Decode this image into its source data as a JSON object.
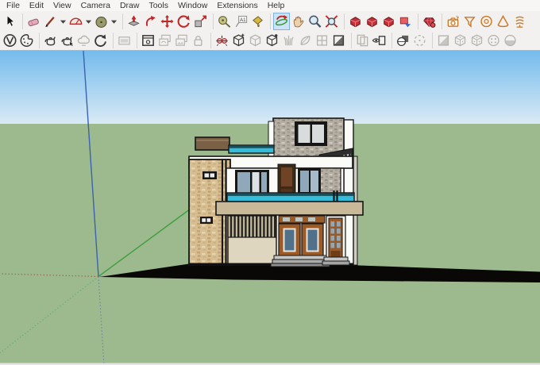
{
  "menu": {
    "items": [
      "File",
      "Edit",
      "View",
      "Camera",
      "Draw",
      "Tools",
      "Window",
      "Extensions",
      "Help"
    ]
  },
  "toolbars": {
    "row1": [
      {
        "name": "select-tool",
        "glyph": "cursor"
      },
      {
        "glyph": "sep"
      },
      {
        "name": "eraser-tool",
        "glyph": "eraser"
      },
      {
        "name": "line-tool",
        "glyph": "pencil"
      },
      {
        "name": "line-tool-dropdown",
        "glyph": "dd"
      },
      {
        "name": "arc-tool",
        "glyph": "protractor"
      },
      {
        "name": "arc-tool-dropdown",
        "glyph": "dd"
      },
      {
        "name": "shape-tool",
        "glyph": "circle"
      },
      {
        "name": "shape-tool-dropdown",
        "glyph": "dd"
      },
      {
        "glyph": "sep"
      },
      {
        "name": "push-pull-tool",
        "glyph": "pushpull"
      },
      {
        "name": "follow-me-tool",
        "glyph": "followme"
      },
      {
        "name": "move-tool",
        "glyph": "movecross"
      },
      {
        "name": "rotate-tool",
        "glyph": "rotate2"
      },
      {
        "name": "scale-tool",
        "glyph": "scale"
      },
      {
        "glyph": "sep"
      },
      {
        "name": "tape-measure-tool",
        "glyph": "tape"
      },
      {
        "name": "dimension-tool",
        "glyph": "textA1"
      },
      {
        "name": "paint-bucket-tool",
        "glyph": "bucket"
      },
      {
        "glyph": "sep"
      },
      {
        "name": "orbit-tool",
        "glyph": "orbit",
        "sel": true
      },
      {
        "name": "pan-tool",
        "glyph": "hand"
      },
      {
        "name": "zoom-tool",
        "glyph": "mag"
      },
      {
        "name": "zoom-extents-tool",
        "glyph": "magext"
      },
      {
        "glyph": "sep"
      },
      {
        "name": "position-camera-tool",
        "glyph": "redbox"
      },
      {
        "name": "look-around-tool",
        "glyph": "redbox"
      },
      {
        "name": "walk-tool",
        "glyph": "redbox"
      },
      {
        "name": "section-plane-tool",
        "glyph": "redblue"
      },
      {
        "glyph": "sep"
      },
      {
        "name": "match-photo-tool",
        "glyph": "gem"
      },
      {
        "glyph": "sep"
      },
      {
        "name": "scenes-camera-tool",
        "glyph": "camstar",
        "c": "#C87828"
      },
      {
        "name": "shape-funnel-tool",
        "glyph": "funnel",
        "c": "#C87828"
      },
      {
        "name": "shape-torus-tool",
        "glyph": "torus",
        "c": "#C87828"
      },
      {
        "name": "shape-cone-tool",
        "glyph": "cone",
        "c": "#C87828"
      },
      {
        "name": "shape-spring-tool",
        "glyph": "spiral",
        "c": "#C87828"
      }
    ],
    "row2": [
      {
        "name": "vray-logo-button",
        "glyph": "vraylogo"
      },
      {
        "name": "vray-asset-editor",
        "glyph": "palette"
      },
      {
        "glyph": "sep"
      },
      {
        "name": "vray-render",
        "glyph": "teapot"
      },
      {
        "name": "vray-render-interactive",
        "glyph": "teapothand"
      },
      {
        "name": "vray-render-cloud",
        "glyph": "cloud",
        "dis": true
      },
      {
        "name": "vray-update-view",
        "glyph": "refresh"
      },
      {
        "glyph": "sep"
      },
      {
        "name": "vray-viewport-render",
        "glyph": "smallframe",
        "dis": true
      },
      {
        "glyph": "sep"
      },
      {
        "name": "vray-frame-buffer",
        "glyph": "framewin"
      },
      {
        "name": "vray-batch-render",
        "glyph": "frames_t",
        "dis": true
      },
      {
        "name": "vray-pack-project",
        "glyph": "frames_i",
        "dis": true
      },
      {
        "name": "vray-lock-camera",
        "glyph": "lock",
        "dis": true
      },
      {
        "glyph": "sep"
      },
      {
        "name": "vray-camera-gizmo",
        "glyph": "gizmo"
      },
      {
        "name": "vray-infinite-plane",
        "glyph": "cubestar"
      },
      {
        "name": "vray-proxy-box",
        "glyph": "cube",
        "dis": true
      },
      {
        "name": "vray-proxy-export",
        "glyph": "cubedot"
      },
      {
        "name": "vray-fur-tool",
        "glyph": "grass",
        "dis": true
      },
      {
        "name": "vray-scatter-tool",
        "glyph": "leaf",
        "dis": true
      },
      {
        "name": "vray-clipper-tool",
        "glyph": "grid4",
        "dis": true
      },
      {
        "name": "vray-decal-tool",
        "glyph": "splitsq"
      },
      {
        "glyph": "sep"
      },
      {
        "name": "vray-light-rect",
        "glyph": "rects2",
        "dis": true
      },
      {
        "name": "vray-light-spot",
        "glyph": "eyerect"
      },
      {
        "glyph": "sep"
      },
      {
        "name": "vray-light-sphere",
        "glyph": "spheresq"
      },
      {
        "name": "vray-light-dome",
        "glyph": "dashcircle",
        "dis": true
      },
      {
        "glyph": "sep"
      },
      {
        "name": "vray-util-split",
        "glyph": "splitsq",
        "dis": true
      },
      {
        "name": "vray-util-proxy-a",
        "glyph": "dice",
        "dis": true
      },
      {
        "name": "vray-util-proxy-b",
        "glyph": "dice",
        "dis": true
      },
      {
        "name": "vray-util-sphere",
        "glyph": "spheredots",
        "dis": true
      },
      {
        "name": "vray-util-halfsphere",
        "glyph": "halfsphere",
        "dis": true
      }
    ],
    "icon_enabled_color": "#3A3A3A",
    "icon_disabled_color": "#B8B5B0"
  },
  "colors": {
    "sky_top": "#74BBEC",
    "sky_horizon": "#DAEAF5",
    "ground": "#9CBA8E",
    "shadow": "#0A0806",
    "axis_blue": "#3A62B0",
    "axis_green": "#3FA03F",
    "axis_red": "#C05A4A",
    "tan_stone": "#D6BD92",
    "gray_stone": "#B4ADA1",
    "white_wall": "#FBFBF8",
    "cyan_glass": "#35BCD8",
    "cyan_dark": "#17505C",
    "fascia": "#C9B999",
    "roof_slab": "#7A6044",
    "door_brown": "#9C5A26",
    "door_glass": "#51708A",
    "glass_blue": "#8FA8BA",
    "beige_wall": "#DFD6BF"
  },
  "scene": {
    "description": "Two-story modern house 3D model, front elevation, with cast shadow and drawing axes"
  }
}
